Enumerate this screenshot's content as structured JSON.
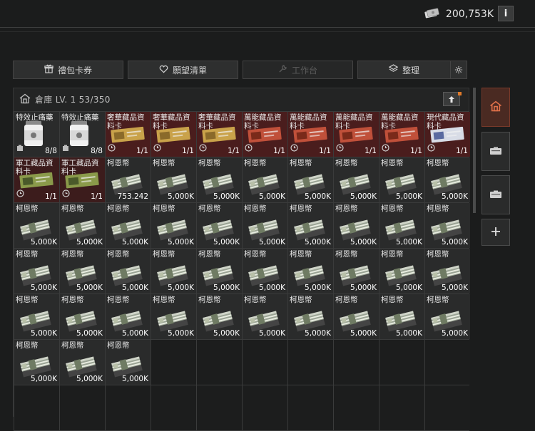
{
  "header": {
    "currency_value": "200,753K",
    "currency_icon": "cash-stack-icon",
    "info_label": "i"
  },
  "tabs": [
    {
      "label": "禮包卡券",
      "icon": "gift-icon"
    },
    {
      "label": "願望清單",
      "icon": "heart-icon"
    },
    {
      "label": "工作台",
      "icon": "wrench-icon"
    },
    {
      "label": "整理",
      "icon": "layers-icon"
    }
  ],
  "stash": {
    "label": "倉庫 LV. 1 53/350"
  },
  "items": [
    {
      "name": "特效止痛藥",
      "qty": "8/8",
      "type": "medic"
    },
    {
      "name": "特效止痛藥",
      "qty": "8/8",
      "type": "medic"
    },
    {
      "name": "奢華藏品資料卡",
      "qty": "1/1",
      "type": "luxury"
    },
    {
      "name": "奢華藏品資料卡",
      "qty": "1/1",
      "type": "luxury"
    },
    {
      "name": "奢華藏品資料卡",
      "qty": "1/1",
      "type": "luxury"
    },
    {
      "name": "萬能藏品資料卡",
      "qty": "1/1",
      "type": "universal"
    },
    {
      "name": "萬能藏品資料卡",
      "qty": "1/1",
      "type": "universal"
    },
    {
      "name": "萬能藏品資料卡",
      "qty": "1/1",
      "type": "universal"
    },
    {
      "name": "萬能藏品資料卡",
      "qty": "1/1",
      "type": "universal"
    },
    {
      "name": "現代藏品資料卡",
      "qty": "1/1",
      "type": "modern"
    },
    {
      "name": "軍工藏品資料卡",
      "qty": "1/1",
      "type": "military"
    },
    {
      "name": "軍工藏品資料卡",
      "qty": "1/1",
      "type": "military"
    },
    {
      "name": "柯恩幣",
      "qty": "753.242",
      "type": "cash"
    },
    {
      "name": "柯恩幣",
      "qty": "5,000K",
      "type": "cash"
    },
    {
      "name": "柯恩幣",
      "qty": "5,000K",
      "type": "cash"
    },
    {
      "name": "柯恩幣",
      "qty": "5,000K",
      "type": "cash"
    },
    {
      "name": "柯恩幣",
      "qty": "5,000K",
      "type": "cash"
    },
    {
      "name": "柯恩幣",
      "qty": "5,000K",
      "type": "cash"
    },
    {
      "name": "柯恩幣",
      "qty": "5,000K",
      "type": "cash"
    },
    {
      "name": "柯恩幣",
      "qty": "5,000K",
      "type": "cash"
    },
    {
      "name": "柯恩幣",
      "qty": "5,000K",
      "type": "cash"
    },
    {
      "name": "柯恩幣",
      "qty": "5,000K",
      "type": "cash"
    },
    {
      "name": "柯恩幣",
      "qty": "5,000K",
      "type": "cash"
    },
    {
      "name": "柯恩幣",
      "qty": "5,000K",
      "type": "cash"
    },
    {
      "name": "柯恩幣",
      "qty": "5,000K",
      "type": "cash"
    },
    {
      "name": "柯恩幣",
      "qty": "5,000K",
      "type": "cash"
    },
    {
      "name": "柯恩幣",
      "qty": "5,000K",
      "type": "cash"
    },
    {
      "name": "柯恩幣",
      "qty": "5,000K",
      "type": "cash"
    },
    {
      "name": "柯恩幣",
      "qty": "5,000K",
      "type": "cash"
    },
    {
      "name": "柯恩幣",
      "qty": "5,000K",
      "type": "cash"
    },
    {
      "name": "柯恩幣",
      "qty": "5,000K",
      "type": "cash"
    },
    {
      "name": "柯恩幣",
      "qty": "5,000K",
      "type": "cash"
    },
    {
      "name": "柯恩幣",
      "qty": "5,000K",
      "type": "cash"
    },
    {
      "name": "柯恩幣",
      "qty": "5,000K",
      "type": "cash"
    },
    {
      "name": "柯恩幣",
      "qty": "5,000K",
      "type": "cash"
    },
    {
      "name": "柯恩幣",
      "qty": "5,000K",
      "type": "cash"
    },
    {
      "name": "柯恩幣",
      "qty": "5,000K",
      "type": "cash"
    },
    {
      "name": "柯恩幣",
      "qty": "5,000K",
      "type": "cash"
    },
    {
      "name": "柯恩幣",
      "qty": "5,000K",
      "type": "cash"
    },
    {
      "name": "柯恩幣",
      "qty": "5,000K",
      "type": "cash"
    },
    {
      "name": "柯恩幣",
      "qty": "5,000K",
      "type": "cash"
    },
    {
      "name": "柯恩幣",
      "qty": "5,000K",
      "type": "cash"
    },
    {
      "name": "柯恩幣",
      "qty": "5,000K",
      "type": "cash"
    },
    {
      "name": "柯恩幣",
      "qty": "5,000K",
      "type": "cash"
    },
    {
      "name": "柯恩幣",
      "qty": "5,000K",
      "type": "cash"
    },
    {
      "name": "柯恩幣",
      "qty": "5,000K",
      "type": "cash"
    },
    {
      "name": "柯恩幣",
      "qty": "5,000K",
      "type": "cash"
    },
    {
      "name": "柯恩幣",
      "qty": "5,000K",
      "type": "cash"
    },
    {
      "name": "柯恩幣",
      "qty": "5,000K",
      "type": "cash"
    },
    {
      "name": "柯恩幣",
      "qty": "5,000K",
      "type": "cash"
    },
    {
      "name": "柯恩幣",
      "qty": "5,000K",
      "type": "cash"
    },
    {
      "name": "柯恩幣",
      "qty": "5,000K",
      "type": "cash"
    },
    {
      "name": "柯恩幣",
      "qty": "5,000K",
      "type": "cash"
    }
  ],
  "empty_slots": 17,
  "sidebar": [
    {
      "icon": "home-icon",
      "active": true
    },
    {
      "icon": "storage-case-icon",
      "active": false
    },
    {
      "icon": "storage-case-icon",
      "active": false
    },
    {
      "icon": "plus-icon",
      "active": false
    }
  ],
  "colors": {
    "accent": "#e07a2a",
    "luxury_bg": "#4a1d1d",
    "military_bg": "#3c1c1c"
  }
}
